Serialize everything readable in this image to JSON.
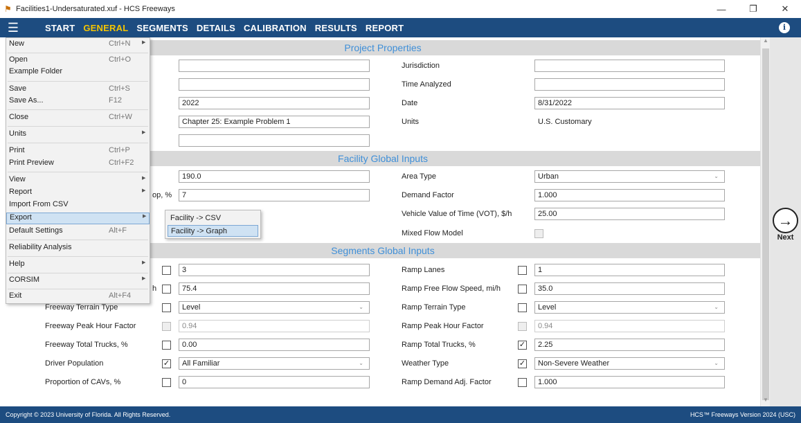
{
  "window": {
    "title": "Facilities1-Undersaturated.xuf - HCS Freeways",
    "minimize": "—",
    "restore": "❐",
    "close": "✕"
  },
  "nav": {
    "items": [
      "START",
      "GENERAL",
      "SEGMENTS",
      "DETAILS",
      "CALIBRATION",
      "RESULTS",
      "REPORT"
    ],
    "active": "GENERAL"
  },
  "sections": {
    "project": "Project Properties",
    "facility": "Facility Global Inputs",
    "segments": "Segments Global Inputs"
  },
  "project": {
    "left_values": [
      "",
      "",
      "2022",
      "Chapter 25: Example Problem 1",
      ""
    ],
    "jurisdiction_label": "Jurisdiction",
    "time_analyzed_label": "Time Analyzed",
    "date_label": "Date",
    "date_value": "8/31/2022",
    "units_label": "Units",
    "units_value": "U.S. Customary"
  },
  "facility": {
    "left_field_1": "190.0",
    "left_label_partial": "op, %",
    "left_field_2": "7",
    "area_type_label": "Area Type",
    "area_type_value": "Urban",
    "demand_factor_label": "Demand Factor",
    "demand_factor_value": "1.000",
    "vot_label": "Vehicle Value of Time (VOT), $/h",
    "vot_value": "25.00",
    "mixed_flow_label": "Mixed Flow Model"
  },
  "segments": {
    "left": [
      {
        "label": "",
        "value": "3",
        "checked": false
      },
      {
        "label": "h",
        "value": "75.4",
        "checked": false
      },
      {
        "label": "Freeway Terrain Type",
        "value": "Level",
        "checked": false,
        "dropdown": true
      },
      {
        "label": "Freeway Peak Hour Factor",
        "value": "0.94",
        "checked": false,
        "disabled": true
      },
      {
        "label": "Freeway Total Trucks, %",
        "value": "0.00",
        "checked": false
      },
      {
        "label": "Driver Population",
        "value": "All Familiar",
        "checked": true,
        "dropdown": true
      },
      {
        "label": "Proportion of CAVs, %",
        "value": "0",
        "checked": false
      }
    ],
    "right": [
      {
        "label": "Ramp Lanes",
        "value": "1",
        "checked": false
      },
      {
        "label": "Ramp Free Flow Speed, mi/h",
        "value": "35.0",
        "checked": false
      },
      {
        "label": "Ramp Terrain Type",
        "value": "Level",
        "checked": false,
        "dropdown": true
      },
      {
        "label": "Ramp Peak Hour Factor",
        "value": "0.94",
        "checked": false,
        "disabled": true
      },
      {
        "label": "Ramp Total Trucks, %",
        "value": "2.25",
        "checked": true
      },
      {
        "label": "Weather Type",
        "value": "Non-Severe Weather",
        "checked": true,
        "dropdown": true
      },
      {
        "label": "Ramp Demand Adj. Factor",
        "value": "1.000",
        "checked": false
      }
    ]
  },
  "menu": {
    "items": [
      {
        "label": "New",
        "shortcut": "Ctrl+N",
        "arrow": true
      },
      {
        "label": "Open",
        "shortcut": "Ctrl+O"
      },
      {
        "label": "Example Folder",
        "shortcut": ""
      },
      {
        "label": "Save",
        "shortcut": "Ctrl+S"
      },
      {
        "label": "Save As...",
        "shortcut": "F12"
      },
      {
        "label": "Close",
        "shortcut": "Ctrl+W"
      },
      {
        "label": "Units",
        "shortcut": "",
        "arrow": true
      },
      {
        "label": "Print",
        "shortcut": "Ctrl+P"
      },
      {
        "label": "Print Preview",
        "shortcut": "Ctrl+F2"
      },
      {
        "label": "View",
        "shortcut": "",
        "arrow": true
      },
      {
        "label": "Report",
        "shortcut": "",
        "arrow": true
      },
      {
        "label": "Import From CSV",
        "shortcut": ""
      },
      {
        "label": "Export",
        "shortcut": "",
        "arrow": true,
        "highlight": true
      },
      {
        "label": "Default Settings",
        "shortcut": "Alt+F"
      },
      {
        "label": "Reliability Analysis",
        "shortcut": ""
      },
      {
        "label": "Help",
        "shortcut": "",
        "arrow": true
      },
      {
        "label": "CORSIM",
        "shortcut": "",
        "arrow": true
      },
      {
        "label": "Exit",
        "shortcut": "Alt+F4"
      }
    ],
    "export_submenu": [
      "Facility -> CSV",
      "Facility -> Graph"
    ]
  },
  "next_label": "Next",
  "footer": {
    "copyright": "Copyright © 2023 University of Florida. All Rights Reserved.",
    "version": "HCS™ Freeways Version 2024 (USC)"
  }
}
